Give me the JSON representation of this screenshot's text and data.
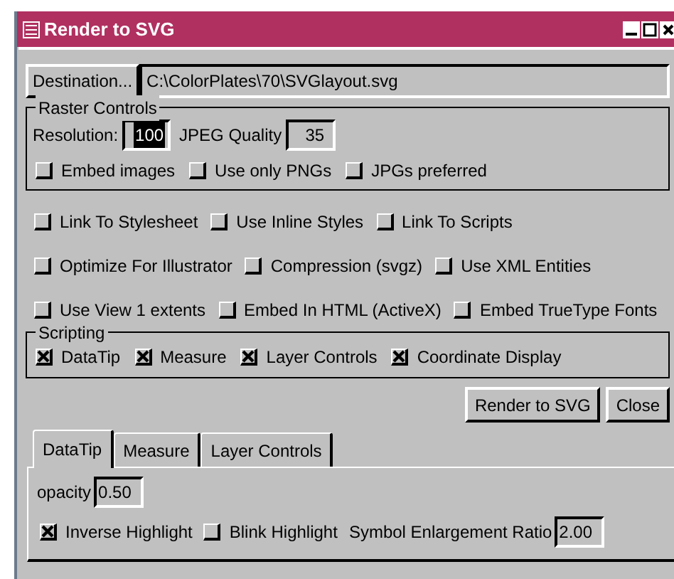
{
  "window": {
    "title": "Render to SVG"
  },
  "destination": {
    "button": "Destination...",
    "path": "C:\\ColorPlates\\70\\SVGlayout.svg"
  },
  "raster_controls": {
    "title": "Raster Controls",
    "resolution": {
      "label": "Resolution:",
      "value": "100",
      "selected": true
    },
    "jpeg_quality": {
      "label": "JPEG Quality",
      "value": "35",
      "selected": false
    },
    "options": [
      {
        "label": "Embed images",
        "checked": false
      },
      {
        "label": "Use only PNGs",
        "checked": false
      },
      {
        "label": "JPGs preferred",
        "checked": false
      }
    ]
  },
  "option_rows": [
    [
      {
        "label": "Link To Stylesheet",
        "checked": false
      },
      {
        "label": "Use Inline Styles",
        "checked": false
      },
      {
        "label": "Link To Scripts",
        "checked": false
      }
    ],
    [
      {
        "label": "Optimize For Illustrator",
        "checked": false
      },
      {
        "label": "Compression (svgz)",
        "checked": false
      },
      {
        "label": "Use XML Entities",
        "checked": false
      }
    ],
    [
      {
        "label": "Use View 1 extents",
        "checked": false
      },
      {
        "label": "Embed In HTML (ActiveX)",
        "checked": false
      },
      {
        "label": "Embed TrueType Fonts",
        "checked": false
      }
    ]
  ],
  "scripting": {
    "title": "Scripting",
    "options": [
      {
        "label": "DataTip",
        "checked": true
      },
      {
        "label": "Measure",
        "checked": true
      },
      {
        "label": "Layer Controls",
        "checked": true
      },
      {
        "label": "Coordinate Display",
        "checked": true
      }
    ]
  },
  "buttons": [
    "Render to SVG",
    "Close"
  ],
  "tabs": [
    {
      "label": "DataTip",
      "selected": true
    },
    {
      "label": "Measure",
      "selected": false
    },
    {
      "label": "Layer Controls",
      "selected": false
    }
  ],
  "datatip_panel": {
    "opacity": {
      "label": "opacity",
      "value": "0.50"
    },
    "options": [
      {
        "label": "Inverse Highlight",
        "checked": true
      },
      {
        "label": "Blink Highlight",
        "checked": false
      }
    ],
    "enlargement": {
      "label": "Symbol Enlargement Ratio",
      "value": "2.00"
    }
  }
}
